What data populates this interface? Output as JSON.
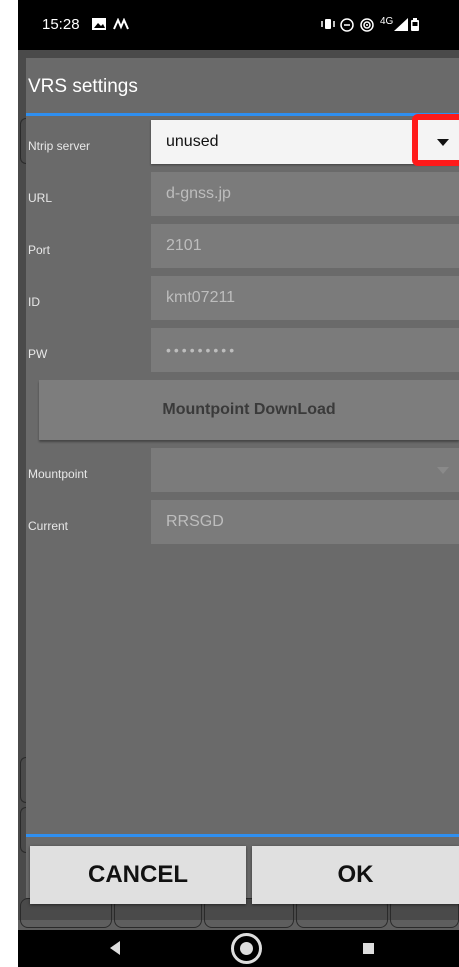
{
  "status_bar": {
    "time": "15:28",
    "icons": [
      "image-icon",
      "signal-wave-icon",
      "vibrate-icon",
      "dnd-icon",
      "hotspot-icon",
      "network-4g-icon",
      "battery-icon"
    ],
    "network_label": "4G"
  },
  "dialog": {
    "title": "VRS settings",
    "fields": [
      {
        "label": "Ntrip server",
        "value": "unused",
        "type": "dropdown"
      },
      {
        "label": "URL",
        "value": "d-gnss.jp",
        "type": "text"
      },
      {
        "label": "Port",
        "value": "2101",
        "type": "text"
      },
      {
        "label": "ID",
        "value": "kmt07211",
        "type": "text"
      },
      {
        "label": "PW",
        "value": "•••••••••",
        "type": "password"
      }
    ],
    "mountpoint_button": "Mountpoint DownLoad",
    "mountpoint": {
      "label": "Mountpoint",
      "value": ""
    },
    "current": {
      "label": "Current",
      "value": "RRSGD"
    },
    "cancel_label": "CANCEL",
    "ok_label": "OK",
    "accent_color": "#2f8ff0",
    "highlight_color": "#ff1a1a"
  }
}
